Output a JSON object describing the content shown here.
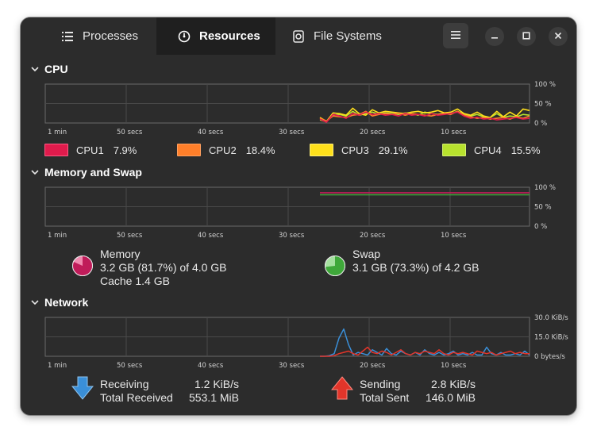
{
  "tabs": [
    {
      "label": "Processes",
      "icon": "list-icon"
    },
    {
      "label": "Resources",
      "icon": "gauge-icon"
    },
    {
      "label": "File Systems",
      "icon": "disk-icon"
    }
  ],
  "active_tab": "Resources",
  "sections": {
    "cpu": "CPU",
    "memory": "Memory and Swap",
    "network": "Network"
  },
  "time_axis": [
    "1 min",
    "50 secs",
    "40 secs",
    "30 secs",
    "20 secs",
    "10 secs"
  ],
  "percent_axis": [
    "100 %",
    "50 %",
    "0 %"
  ],
  "network_axis": [
    "30.0 KiB/s",
    "15.0 KiB/s",
    "0 bytes/s"
  ],
  "cpu": [
    {
      "name": "CPU1",
      "value": "7.9%",
      "color": "#e01b4c"
    },
    {
      "name": "CPU2",
      "value": "18.4%",
      "color": "#ff7f2a"
    },
    {
      "name": "CPU3",
      "value": "29.1%",
      "color": "#ffe01b"
    },
    {
      "name": "CPU4",
      "value": "15.5%",
      "color": "#b8e22e"
    }
  ],
  "memory": {
    "title": "Memory",
    "usage": "3.2 GB (81.7%) of 4.0 GB",
    "cache": "Cache 1.4 GB",
    "fraction": 0.817,
    "color": "#c01c5a"
  },
  "swap": {
    "title": "Swap",
    "usage": "3.1 GB (73.3%) of 4.2 GB",
    "fraction": 0.733,
    "color": "#3fa83a"
  },
  "network": {
    "receiving_label": "Receiving",
    "receiving_value": "1.2 KiB/s",
    "total_received_label": "Total Received",
    "total_received_value": "553.1 MiB",
    "sending_label": "Sending",
    "sending_value": "2.8 KiB/s",
    "total_sent_label": "Total Sent",
    "total_sent_value": "146.0 MiB",
    "receive_color": "#3a8fd8",
    "send_color": "#e2352a"
  }
}
